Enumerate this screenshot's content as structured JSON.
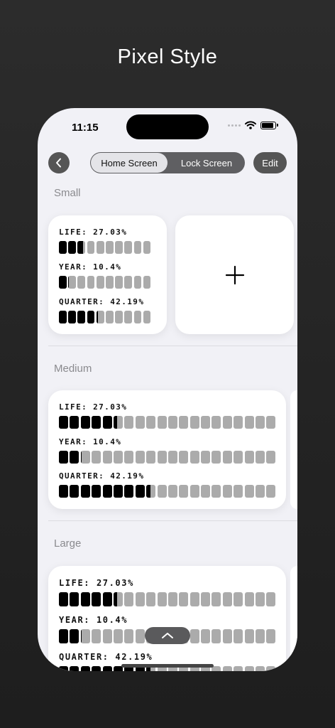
{
  "headline": "Pixel Style",
  "status": {
    "time": "11:15"
  },
  "nav": {
    "tabs": [
      {
        "label": "Home Screen",
        "active": true
      },
      {
        "label": "Lock Screen",
        "active": false
      }
    ],
    "edit_label": "Edit"
  },
  "sections": {
    "small": "Small",
    "medium": "Medium",
    "large": "Large"
  },
  "metrics": [
    {
      "label": "LIFE: 27.03%",
      "progress": 0.2703
    },
    {
      "label": "YEAR: 10.4%",
      "progress": 0.104
    },
    {
      "label": "QUARTER: 42.19%",
      "progress": 0.4219
    }
  ],
  "colors": {
    "filled": "#000000",
    "empty": "#ababab",
    "background": "#f1f1f6",
    "card": "#ffffff"
  },
  "icons": [
    "chevron-left-icon",
    "plus-icon",
    "chevron-up-icon",
    "wifi-icon",
    "battery-icon"
  ]
}
